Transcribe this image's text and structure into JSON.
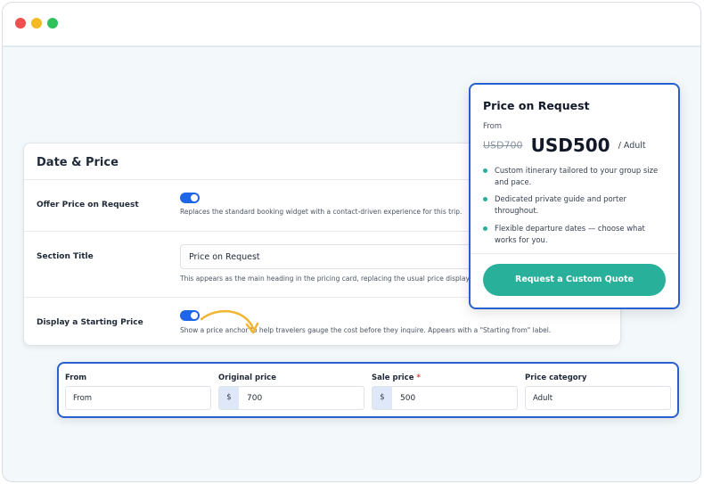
{
  "panel": {
    "title": "Date & Price",
    "rows": [
      {
        "label": "Offer Price on Request",
        "help": "Replaces the standard booking widget with a contact-driven experience for this trip."
      },
      {
        "label": "Section Title",
        "value": "Price on Request",
        "help": "This appears as the main heading in the pricing card, replacing the usual price display."
      },
      {
        "label": "Display a Starting Price",
        "help": "Show a price anchor to help travelers gauge the cost before they inquire. Appears with a \"Starting from\" label."
      }
    ]
  },
  "card": {
    "title": "Price on Request",
    "from": "From",
    "old_price": "USD700",
    "new_price": "USD500",
    "per_unit": "/ Adult",
    "features": [
      "Custom itinerary tailored to your group size and pace.",
      "Dedicated private guide and porter throughout.",
      "Flexible departure dates — choose what works for you."
    ],
    "button": "Request a Custom Quote"
  },
  "fields": {
    "from": {
      "label": "From",
      "value": "From"
    },
    "original": {
      "label": "Original price",
      "prefix": "$",
      "value": "700"
    },
    "sale": {
      "label": "Sale price",
      "required": "*",
      "prefix": "$",
      "value": "500"
    },
    "category": {
      "label": "Price category",
      "value": "Adult"
    }
  },
  "colors": {
    "accent": "#28b09a",
    "toggle": "#1e66e6",
    "highlight_border": "#2a5fcf",
    "arrow": "#f2b531"
  },
  "toggles": {
    "offer_price_on_request": true,
    "display_starting_price": true
  }
}
